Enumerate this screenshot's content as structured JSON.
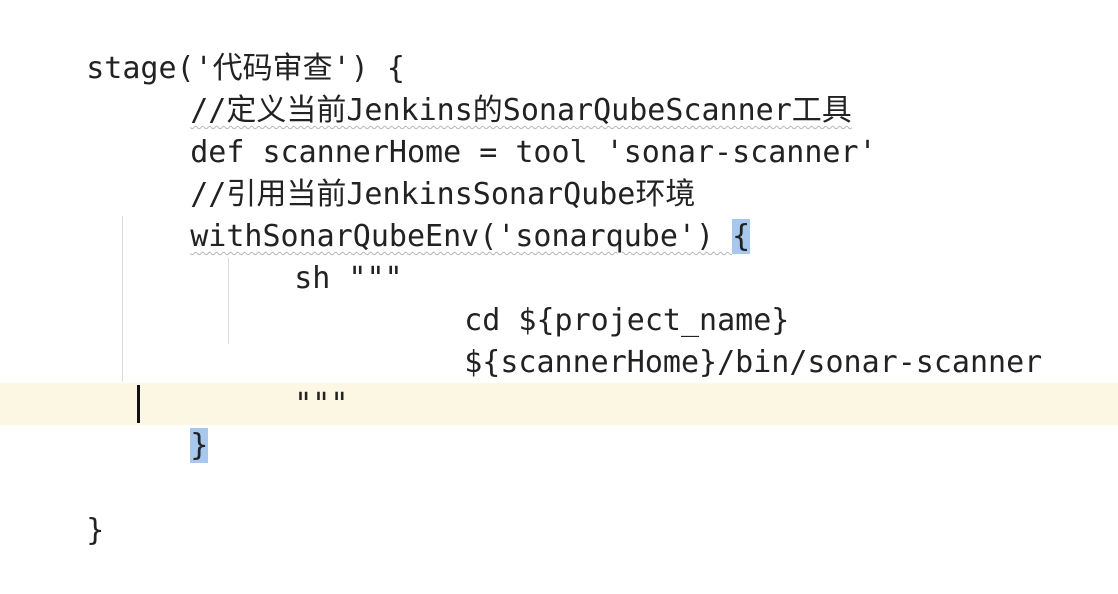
{
  "editor": {
    "current_line_color": "#fbf7e3",
    "bracket_highlight_color": "#a8c7ee",
    "lines": [
      {
        "text": "stage('代码审查') {"
      },
      {
        "text": "//定义当前Jenkins的SonarQubeScanner工具"
      },
      {
        "text": "def scannerHome = tool 'sonar-scanner'"
      },
      {
        "text": "//引用当前JenkinsSonarQube环境"
      },
      {
        "pre": "withSonarQubeEnv('sonarqube') ",
        "brace": "{"
      },
      {
        "text": "sh \"\"\""
      },
      {
        "text": "cd ${project_name}"
      },
      {
        "text": "${scannerHome}/bin/sonar-scanner"
      },
      {
        "text": "\"\"\""
      },
      {
        "brace": "}"
      },
      {
        "text": ""
      },
      {
        "text": "}"
      }
    ]
  }
}
